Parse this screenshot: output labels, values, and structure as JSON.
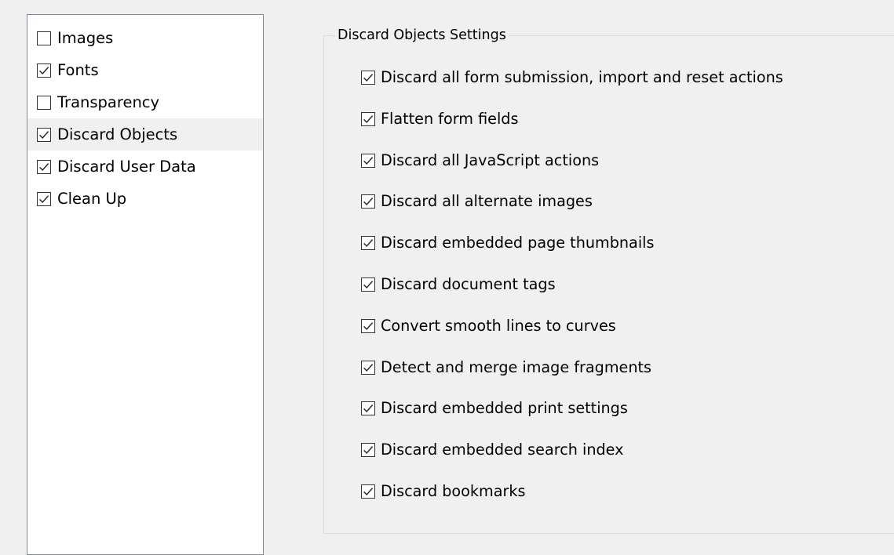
{
  "categories": [
    {
      "label": "Images",
      "checked": false
    },
    {
      "label": "Fonts",
      "checked": true
    },
    {
      "label": "Transparency",
      "checked": false
    },
    {
      "label": "Discard Objects",
      "checked": true,
      "selected": true
    },
    {
      "label": "Discard User Data",
      "checked": true
    },
    {
      "label": "Clean Up",
      "checked": true
    }
  ],
  "settings": {
    "title": "Discard Objects Settings",
    "options": [
      {
        "label": "Discard all form submission, import and reset actions",
        "checked": true
      },
      {
        "label": "Flatten form fields",
        "checked": true
      },
      {
        "label": "Discard all JavaScript actions",
        "checked": true
      },
      {
        "label": "Discard all alternate images",
        "checked": true
      },
      {
        "label": "Discard embedded page thumbnails",
        "checked": true
      },
      {
        "label": "Discard document tags",
        "checked": true
      },
      {
        "label": "Convert smooth lines to curves",
        "checked": true
      },
      {
        "label": "Detect and merge image fragments",
        "checked": true
      },
      {
        "label": "Discard embedded print settings",
        "checked": true
      },
      {
        "label": "Discard embedded search index",
        "checked": true
      },
      {
        "label": "Discard bookmarks",
        "checked": true
      }
    ]
  },
  "colors": {
    "window_bg": "#f0f0f0",
    "list_bg": "#ffffff",
    "list_border": "#828790",
    "group_border": "#d5dfe5",
    "checkbox_border": "#333333",
    "selected_row": "#f0f0f0"
  },
  "icons": {
    "checked": "checkmark-icon"
  }
}
